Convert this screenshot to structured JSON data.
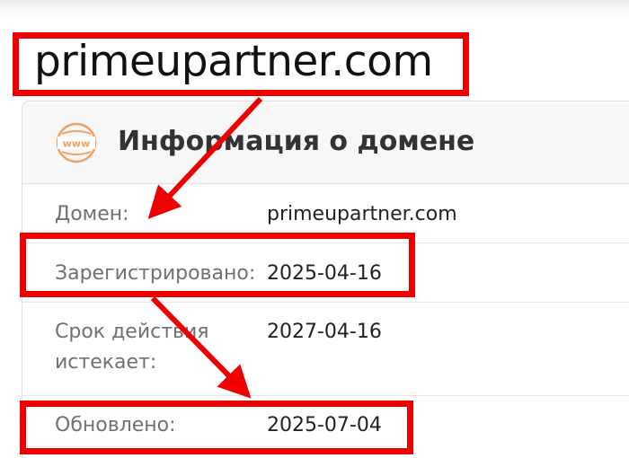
{
  "domain_title": "primeupartner.com",
  "card": {
    "icon": "www-globe-icon",
    "icon_text": "www",
    "title": "Информация о домене",
    "rows": [
      {
        "label": "Домен:",
        "value": "primeupartner.com"
      },
      {
        "label": "Зарегистрировано:",
        "value": "2025-04-16"
      },
      {
        "label": "Срок действия истекает:",
        "value": "2027-04-16"
      },
      {
        "label": "Обновлено:",
        "value": "2025-07-04"
      }
    ]
  },
  "annotations": {
    "highlight_color": "#ee0000",
    "icon_color": "#f0a060"
  }
}
